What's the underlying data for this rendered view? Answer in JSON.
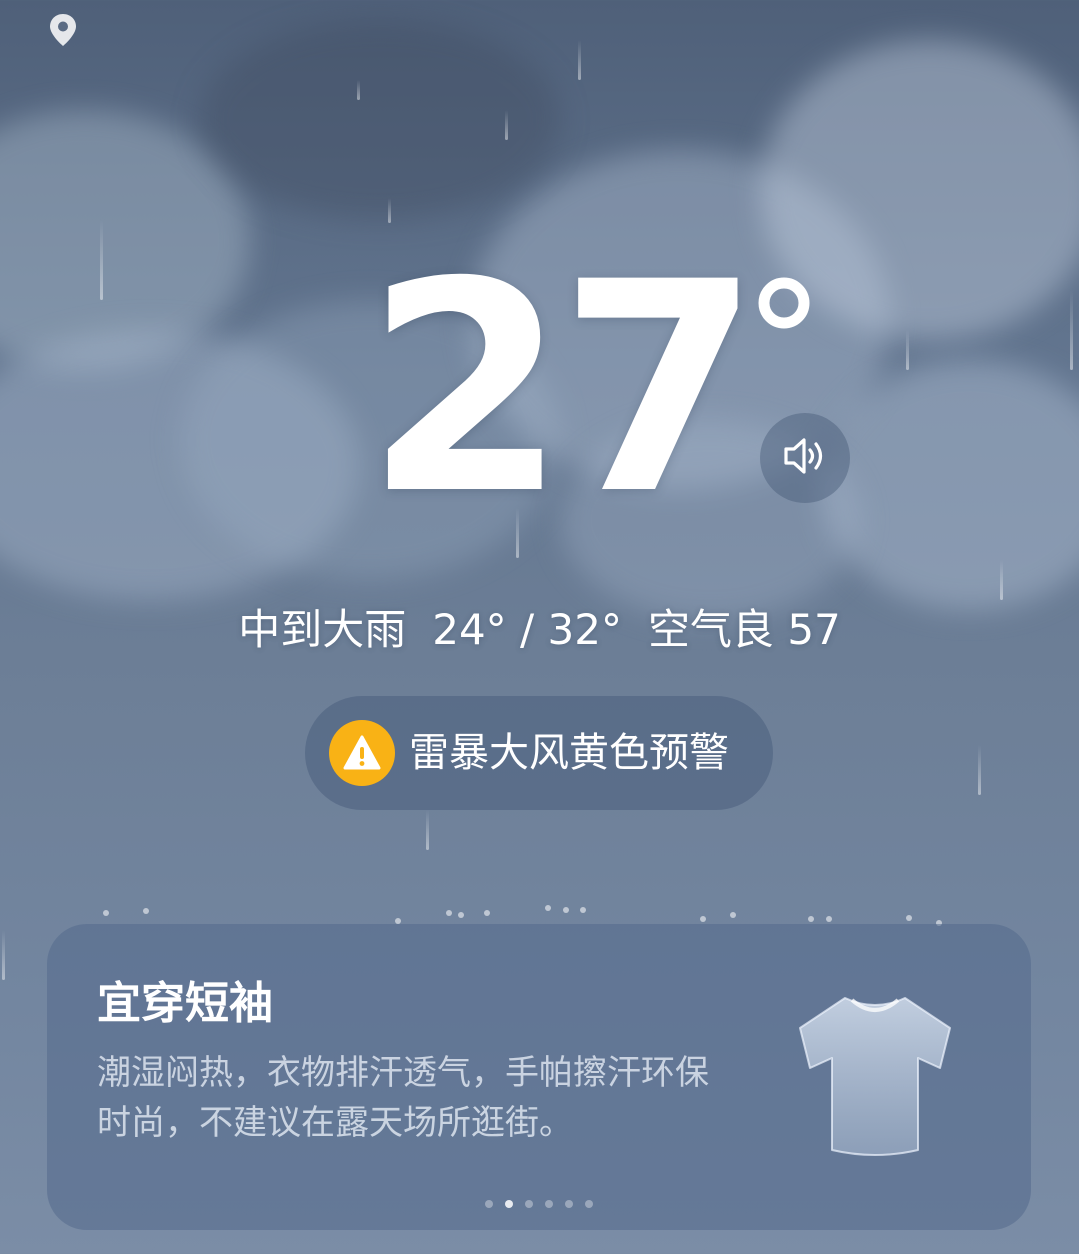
{
  "location": {
    "icon": "location-pin-icon"
  },
  "current": {
    "temperature": "27",
    "degree_icon": "degree-icon"
  },
  "speaker": {
    "icon": "speaker-icon"
  },
  "summary": {
    "condition": "中到大雨",
    "range": "24° / 32°",
    "air_quality": "空气良 57"
  },
  "alert": {
    "icon": "warning-icon",
    "color": "#f9b215",
    "text": "雷暴大风黄色预警"
  },
  "tip_card": {
    "title": "宜穿短袖",
    "body": "潮湿闷热，衣物排汗透气，手帕擦汗环保时尚，不建议在露天场所逛街。",
    "icon": "tshirt-icon",
    "page_count": 6,
    "active_page": 2
  }
}
